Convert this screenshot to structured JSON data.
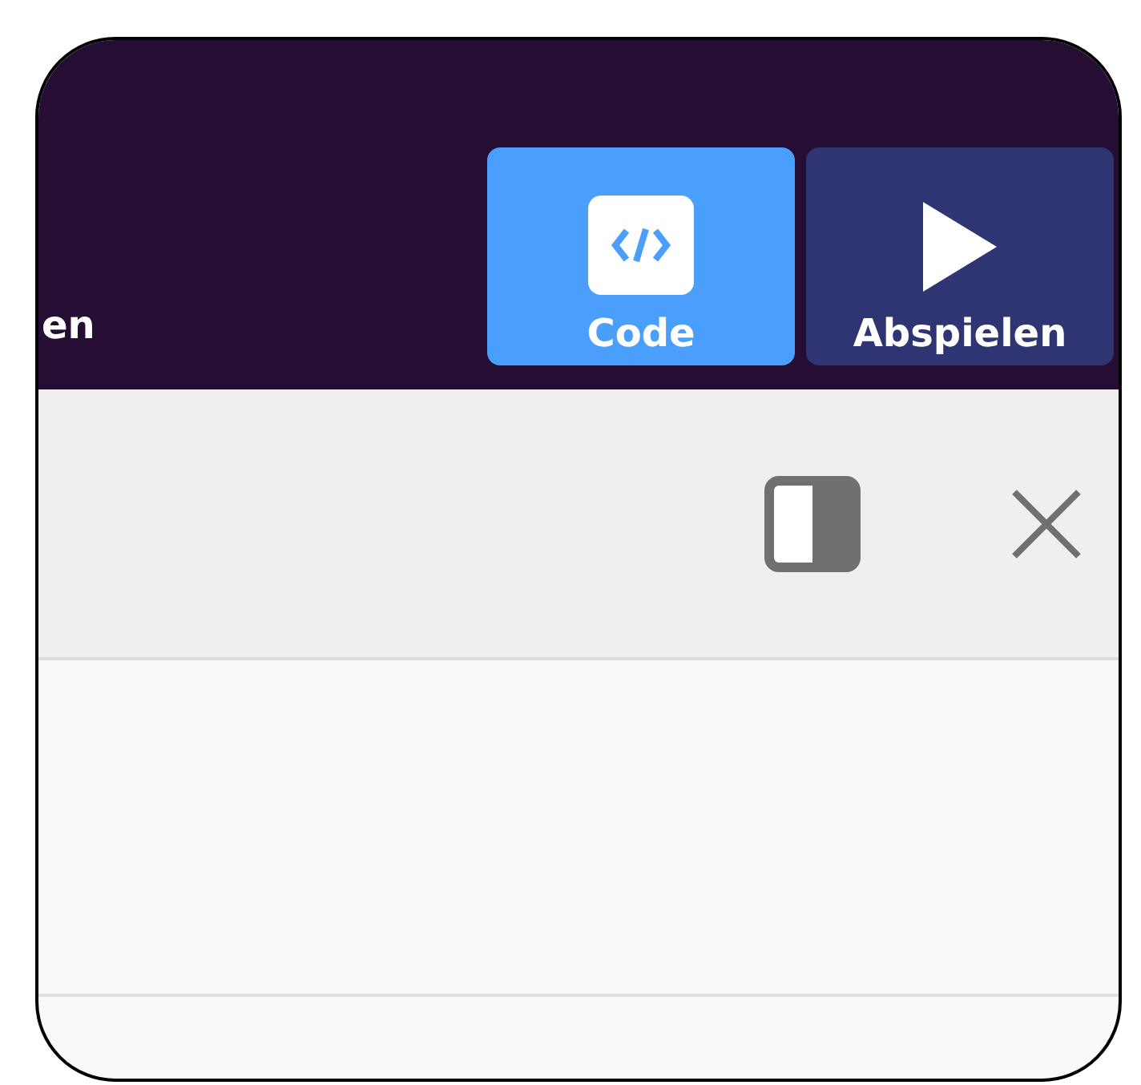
{
  "toolbar": {
    "items": [
      {
        "kind": "text",
        "label": "en",
        "selected": false
      },
      {
        "kind": "code",
        "label": "Code",
        "selected": true
      },
      {
        "kind": "play",
        "label": "Abspielen",
        "selected": false
      }
    ]
  },
  "panel": {
    "header": {
      "buttons": [
        {
          "kind": "layout"
        },
        {
          "kind": "close"
        }
      ]
    }
  }
}
